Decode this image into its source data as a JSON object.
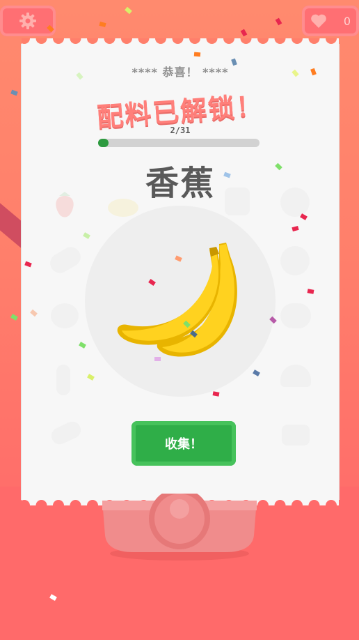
{
  "hud": {
    "heart_count": "0"
  },
  "card": {
    "congrats": "**** 恭喜！ ****",
    "title": "配料已解锁！",
    "progress_text": "2/31",
    "progress_fraction": 0.065,
    "ingredient_name": "香蕉",
    "collect_label": "收集！"
  },
  "colors": {
    "background": "#ff7f6b",
    "title": "#ff7f7a",
    "progress_fill": "#2d9a3f",
    "collect_button": "#2fae48",
    "banana": "#ffd21f"
  },
  "icons": {
    "settings": "gear-icon",
    "lives": "heart-icon",
    "ingredient": "banana-icon"
  }
}
